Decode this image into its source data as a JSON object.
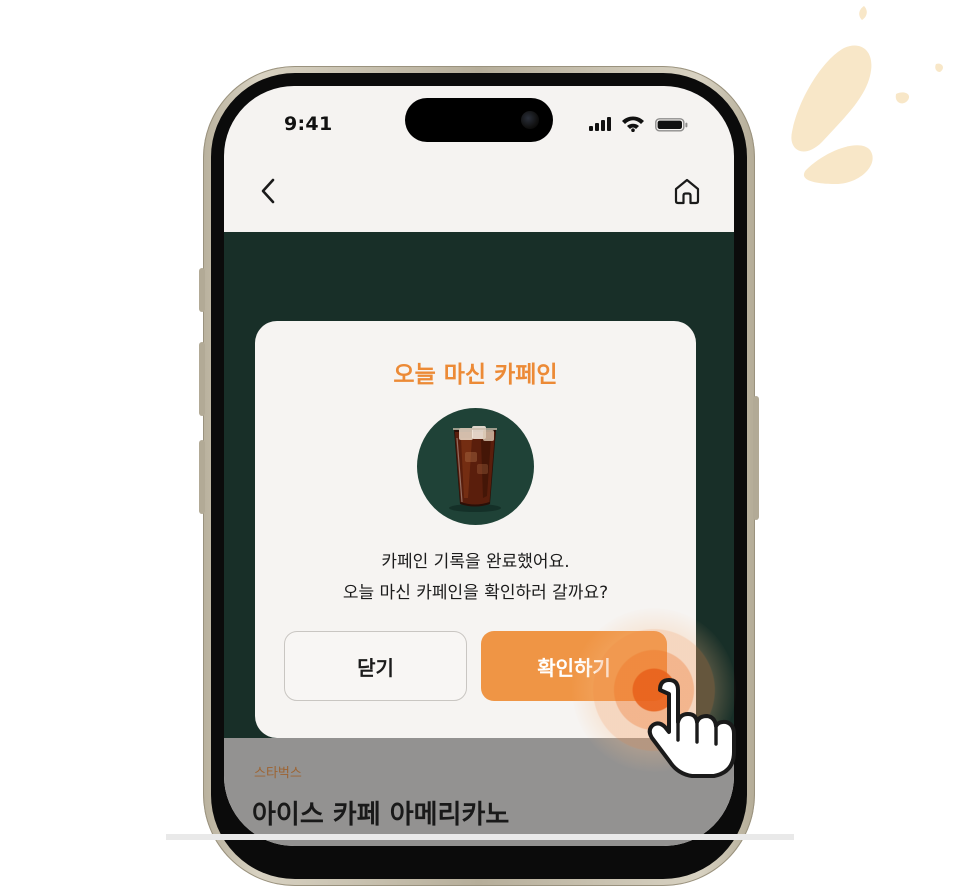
{
  "status_bar": {
    "time": "9:41"
  },
  "nav": {
    "back_icon": "chevron-left-icon",
    "home_icon": "home-icon"
  },
  "modal": {
    "title": "오늘 마신 카페인",
    "message_line1": "카페인 기록을 완료했어요.",
    "message_line2": "오늘 마신 카페인을 확인하러 갈까요?",
    "close_label": "닫기",
    "confirm_label": "확인하기"
  },
  "product": {
    "brand": "스타벅스",
    "name": "아이스 카페 아메리카노"
  },
  "colors": {
    "accent": "#ef9545",
    "title": "#ec8a36",
    "product_bg": "#1e3a31",
    "modal_bg": "#f6f4f2"
  }
}
